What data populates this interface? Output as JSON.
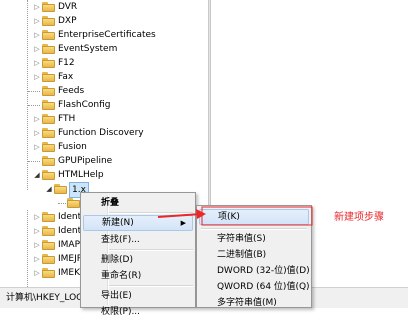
{
  "tree": {
    "keys": [
      "DVR",
      "DXP",
      "EnterpriseCertificates",
      "EventSystem",
      "F12",
      "Fax",
      "Feeds",
      "FlashConfig",
      "FTH",
      "Function Discovery",
      "Fusion",
      "GPUPipeline",
      "HTMLHelp"
    ],
    "selected_key": "1.x",
    "siblings": [
      "Ident",
      "Ident",
      "IMAP",
      "IMEJP",
      "IMEKI"
    ]
  },
  "status_bar": {
    "path": "计算机\\HKEY_LOCAL_MACHINE\\SOFTWARE\\Microsoft"
  },
  "context_menu": {
    "items": [
      {
        "label": "折叠",
        "bold": true
      },
      {
        "label": "新建(N)",
        "highlighted": true,
        "submenu": true
      },
      {
        "label": "查找(F)..."
      },
      {
        "label": "删除(D)"
      },
      {
        "label": "重命名(R)"
      },
      {
        "label": "导出(E)"
      },
      {
        "label": "权限(P)..."
      }
    ]
  },
  "submenu": {
    "items": [
      {
        "label": "项(K)",
        "highlighted": true
      },
      {
        "label": "字符串值(S)"
      },
      {
        "label": "二进制值(B)"
      },
      {
        "label": "DWORD (32-位)值(D)"
      },
      {
        "label": "QWORD (64 位)值(Q)"
      },
      {
        "label": "多字符串值(M)"
      }
    ]
  },
  "annotation": {
    "text": "新建项步骤",
    "color": "#e8282a"
  }
}
